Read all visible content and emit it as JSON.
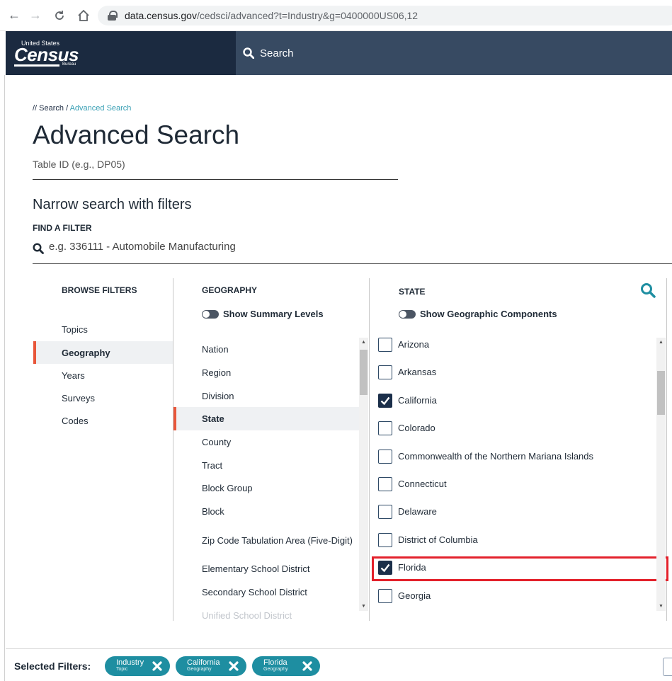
{
  "browser": {
    "url_host": "data.census.gov",
    "url_path": "/cedsci/advanced?t=Industry&g=0400000US06,12"
  },
  "header": {
    "logo_top": "United States",
    "logo_main": "Census",
    "logo_sub": "Bureau",
    "search_label": "Search"
  },
  "breadcrumb": {
    "prefix": "// ",
    "search": "Search",
    "sep": " / ",
    "current": "Advanced Search"
  },
  "page": {
    "title": "Advanced Search",
    "table_id_placeholder": "Table ID (e.g., DP05)",
    "narrow_heading": "Narrow search with filters",
    "find_label": "FIND A FILTER",
    "find_placeholder": "e.g. 336111 - Automobile Manufacturing"
  },
  "browse": {
    "heading": "BROWSE FILTERS",
    "items": [
      "Topics",
      "Geography",
      "Years",
      "Surveys",
      "Codes"
    ],
    "active": "Geography"
  },
  "geography": {
    "heading": "GEOGRAPHY",
    "toggle_label": "Show Summary Levels",
    "items": [
      "Nation",
      "Region",
      "Division",
      "State",
      "County",
      "Tract",
      "Block Group",
      "Block",
      "Zip Code Tabulation Area (Five-Digit)",
      "Elementary School District",
      "Secondary School District",
      "Unified School District"
    ],
    "active": "State"
  },
  "state": {
    "heading": "STATE",
    "toggle_label": "Show Geographic Components",
    "items": [
      {
        "label": "Arizona",
        "checked": false
      },
      {
        "label": "Arkansas",
        "checked": false
      },
      {
        "label": "California",
        "checked": true
      },
      {
        "label": "Colorado",
        "checked": false
      },
      {
        "label": "Commonwealth of the Northern Mariana Islands",
        "checked": false
      },
      {
        "label": "Connecticut",
        "checked": false
      },
      {
        "label": "Delaware",
        "checked": false
      },
      {
        "label": "District of Columbia",
        "checked": false
      },
      {
        "label": "Florida",
        "checked": true
      },
      {
        "label": "Georgia",
        "checked": false
      }
    ]
  },
  "footer": {
    "label": "Selected Filters:",
    "chips": [
      {
        "name": "Industry",
        "category": "Topic"
      },
      {
        "name": "California",
        "category": "Geography"
      },
      {
        "name": "Florida",
        "category": "Geography"
      }
    ]
  },
  "colors": {
    "header_bg": "#374a62",
    "logo_bg": "#1b2a40",
    "accent": "#e8563a",
    "chip": "#1e8ea1",
    "highlight": "#e3212b"
  }
}
